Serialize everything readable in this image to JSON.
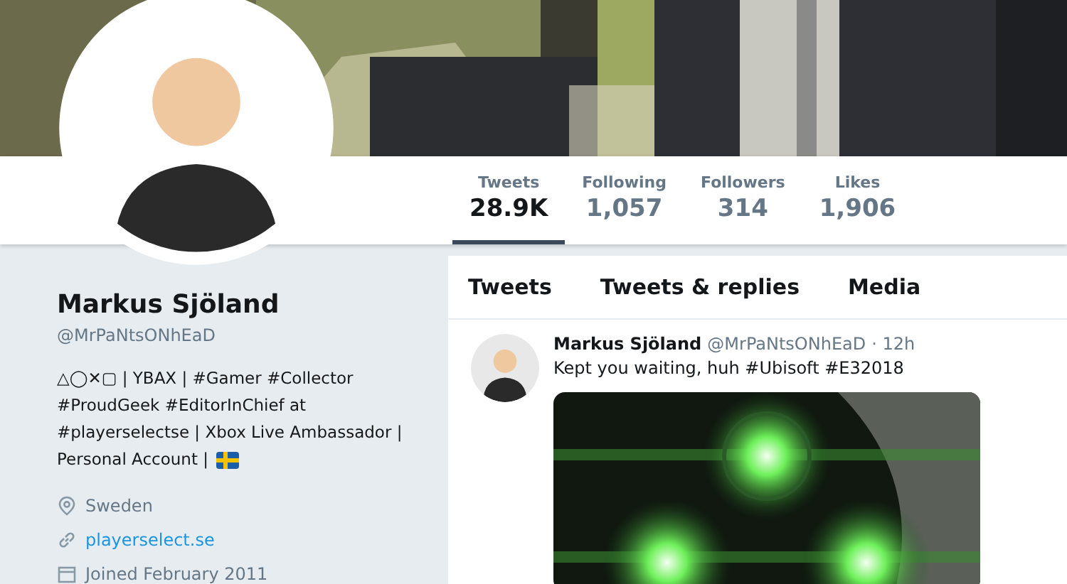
{
  "stats": [
    {
      "label": "Tweets",
      "value": "28.9K",
      "selected": true
    },
    {
      "label": "Following",
      "value": "1,057",
      "selected": false
    },
    {
      "label": "Followers",
      "value": "314",
      "selected": false
    },
    {
      "label": "Likes",
      "value": "1,906",
      "selected": false
    }
  ],
  "profile": {
    "name": "Markus Sjöland",
    "handle": "@MrPaNtsONhEaD",
    "bio": "△◯✕▢ | YBAX | #Gamer #Collector #ProudGeek #EditorInChief at #playerselectse | Xbox Live Ambassador |",
    "bio_end": "Personal Account |",
    "location": "Sweden",
    "website": "playerselect.se",
    "joined": "Joined February 2011"
  },
  "tabs": [
    {
      "label": "Tweets"
    },
    {
      "label": "Tweets & replies"
    },
    {
      "label": "Media"
    }
  ],
  "tweet": {
    "name": "Markus Sjöland",
    "handle": "@MrPaNtsONhEaD",
    "time": "· 12h",
    "text": "Kept you waiting, huh #Ubisoft #E32018"
  }
}
